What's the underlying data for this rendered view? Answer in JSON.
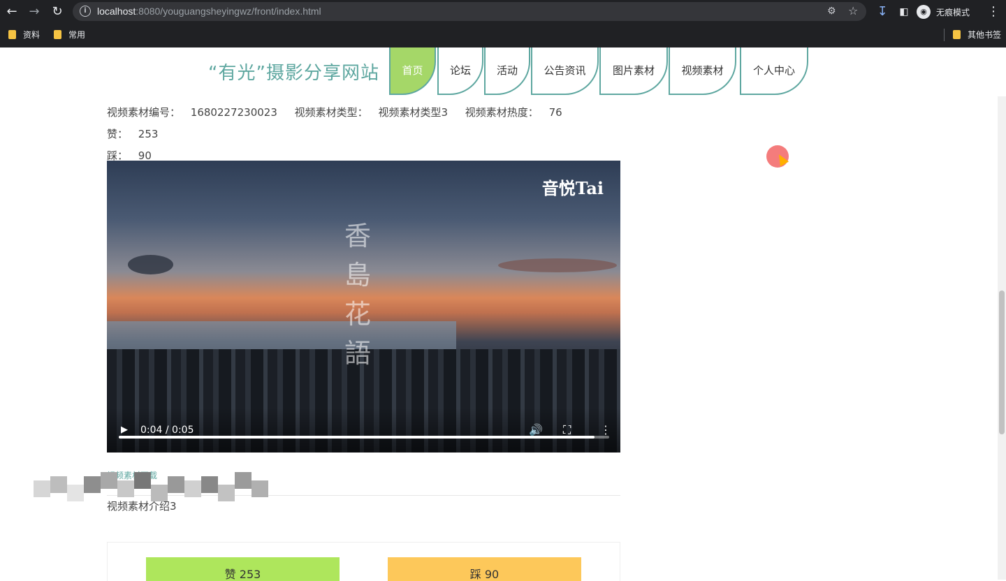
{
  "browser": {
    "url_host": "localhost",
    "url_rest": ":8080/youguangsheyingwz/front/index.html",
    "incognito_label": "无痕模式",
    "bookmarks": [
      "资料",
      "常用"
    ],
    "other_bookmarks": "其他书签"
  },
  "site": {
    "title": "“有光”摄影分享网站",
    "nav": [
      "首页",
      "论坛",
      "活动",
      "公告资讯",
      "图片素材",
      "视频素材",
      "个人中心"
    ],
    "active_nav": "首页"
  },
  "video_material": {
    "fields": [
      {
        "label": "视频素材编号：",
        "value": "1680227230023"
      },
      {
        "label": "视频素材类型：",
        "value": "视频素材类型3"
      },
      {
        "label": "视频素材热度：",
        "value": "76"
      },
      {
        "label": "赞：",
        "value": "253"
      },
      {
        "label": "踩：",
        "value": "90"
      }
    ],
    "player": {
      "watermark": "音悦Tai",
      "calligraphy": "香島花語",
      "time": "0:04 / 0:05",
      "progress": 0.97
    },
    "download_link": "视频素材下载",
    "intro": "视频素材介绍3",
    "like_button": "赞  253",
    "dislike_button": "踩  90"
  }
}
